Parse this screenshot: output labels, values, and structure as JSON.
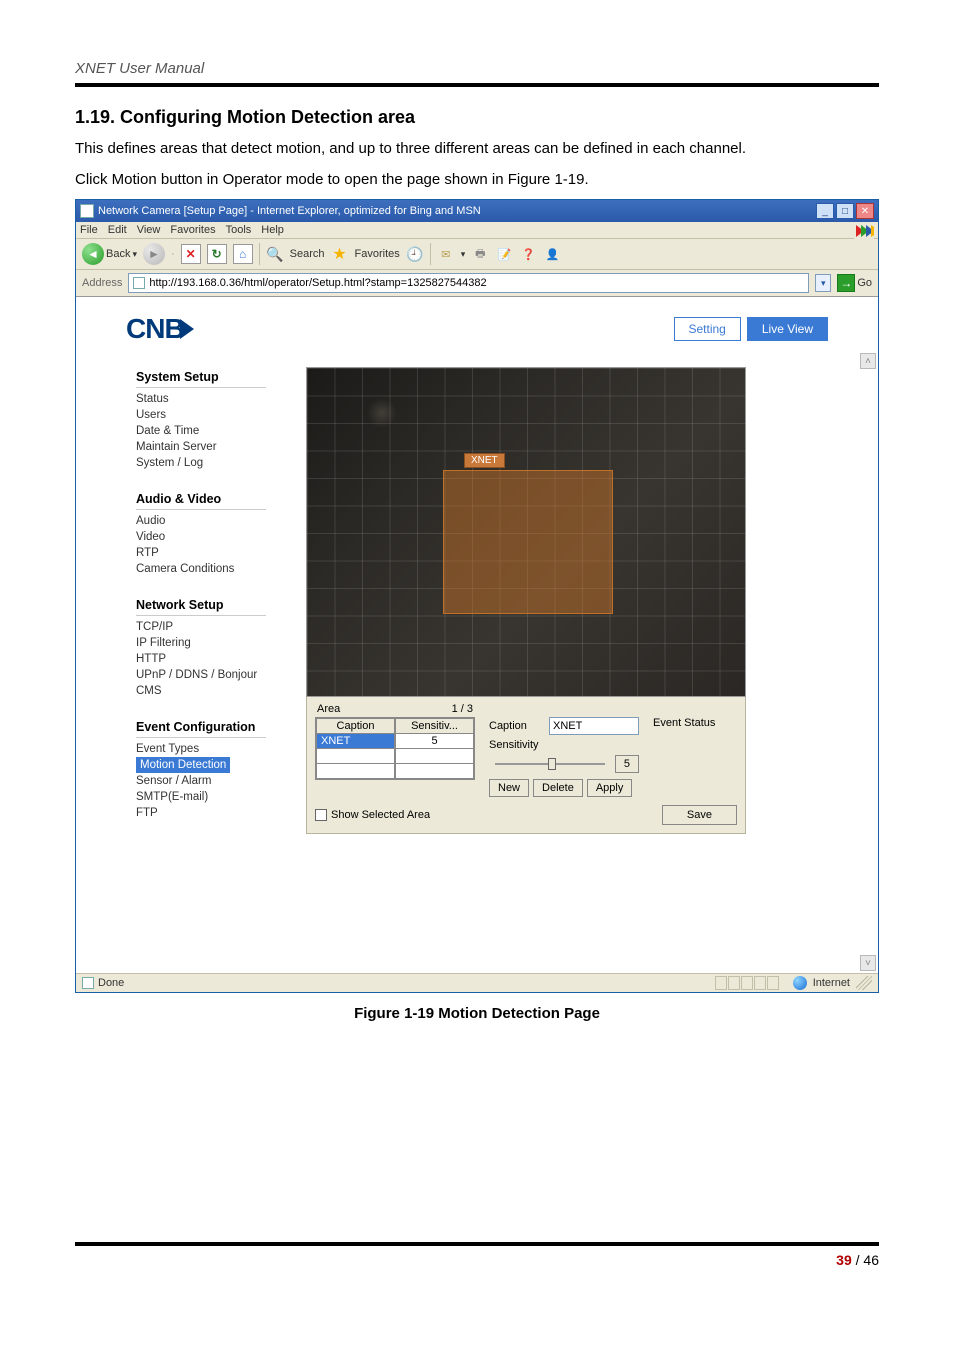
{
  "doc": {
    "header": "XNET User Manual",
    "section_title": "1.19. Configuring Motion Detection area",
    "p1": "This defines areas that detect motion, and up to three different areas can be defined in each channel.",
    "p2": "Click Motion button in Operator mode to open the page shown in Figure 1-19.",
    "fig_caption": "Figure 1-19 Motion Detection Page",
    "page_cur": "39",
    "page_sep": " / ",
    "page_total": "46"
  },
  "ie": {
    "title": "Network Camera [Setup Page] - Internet Explorer, optimized for Bing and MSN",
    "menu": {
      "file": "File",
      "edit": "Edit",
      "view": "View",
      "favorites": "Favorites",
      "tools": "Tools",
      "help": "Help"
    },
    "toolbar": {
      "back": "Back",
      "search": "Search",
      "favorites": "Favorites"
    },
    "address": {
      "label": "Address",
      "url": "http://193.168.0.36/html/operator/Setup.html?stamp=1325827544382",
      "go": "Go"
    },
    "status": {
      "done": "Done",
      "zone": "Internet"
    }
  },
  "cnb": {
    "logo": "CNB",
    "header": {
      "setting": "Setting",
      "liveview": "Live View"
    },
    "sidebar": {
      "g1": {
        "head": "System Setup",
        "i1": "Status",
        "i2": "Users",
        "i3": "Date & Time",
        "i4": "Maintain Server",
        "i5": "System / Log"
      },
      "g2": {
        "head": "Audio & Video",
        "i1": "Audio",
        "i2": "Video",
        "i3": "RTP",
        "i4": "Camera Conditions"
      },
      "g3": {
        "head": "Network Setup",
        "i1": "TCP/IP",
        "i2": "IP Filtering",
        "i3": "HTTP",
        "i4": "UPnP / DDNS / Bonjour",
        "i5": "CMS"
      },
      "g4": {
        "head": "Event Configuration",
        "i1": "Event Types",
        "i2": "Motion Detection",
        "i3": "Sensor / Alarm",
        "i4": "SMTP(E-mail)",
        "i5": "FTP"
      }
    },
    "panel": {
      "region_label": "XNET",
      "area_label": "Area",
      "area_count": "1 / 3",
      "th_caption": "Caption",
      "th_sens": "Sensitiv...",
      "row_caption": "XNET",
      "row_sens": "5",
      "caption_label": "Caption",
      "caption_value": "XNET",
      "sensitivity_label": "Sensitivity",
      "sensitivity_value": "5",
      "event_status_label": "Event Status",
      "btn_new": "New",
      "btn_delete": "Delete",
      "btn_apply": "Apply",
      "show_selected": "Show Selected Area",
      "btn_save": "Save"
    }
  }
}
